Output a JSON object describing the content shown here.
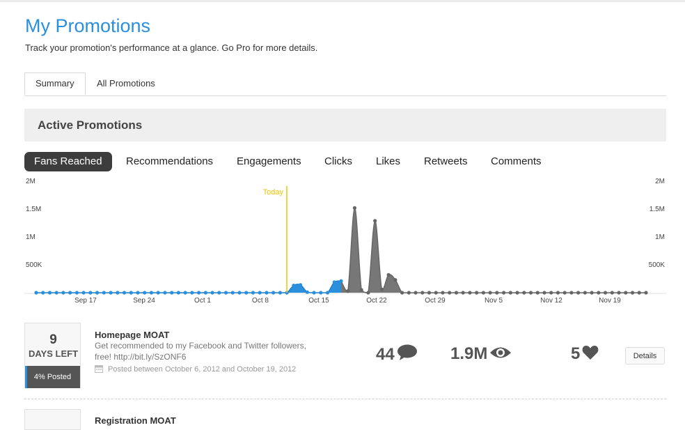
{
  "header": {
    "title": "My Promotions",
    "subtitle": "Track your promotion's performance at a glance. Go Pro for more details."
  },
  "tabs": [
    {
      "label": "Summary",
      "active": true
    },
    {
      "label": "All Promotions",
      "active": false
    }
  ],
  "section": {
    "title": "Active Promotions"
  },
  "metric_tabs": [
    {
      "label": "Fans Reached",
      "active": true
    },
    {
      "label": "Recommendations",
      "active": false
    },
    {
      "label": "Engagements",
      "active": false
    },
    {
      "label": "Clicks",
      "active": false
    },
    {
      "label": "Likes",
      "active": false
    },
    {
      "label": "Retweets",
      "active": false
    },
    {
      "label": "Comments",
      "active": false
    }
  ],
  "chart_data": {
    "type": "area",
    "y_ticks": [
      "2M",
      "1.5M",
      "1M",
      "500K"
    ],
    "ylim": [
      0,
      2000000
    ],
    "x_ticks": [
      "Sep 17",
      "Sep 24",
      "Oct 1",
      "Oct 8",
      "Oct 15",
      "Oct 22",
      "Oct 29",
      "Nov 5",
      "Nov 12",
      "Nov 19"
    ],
    "annotation": "Today",
    "colors": {
      "past": "#2a8fdc",
      "future": "#777777",
      "today": "#f2c200"
    },
    "series": [
      {
        "values": [
          0,
          0,
          0,
          0,
          0,
          0,
          0,
          0,
          0,
          0,
          0,
          0,
          0,
          0,
          0,
          0,
          0,
          0,
          0,
          0,
          0,
          0,
          0,
          0,
          0,
          0,
          0,
          0,
          0,
          0,
          0,
          0,
          0,
          0,
          0,
          0,
          0,
          0,
          130000,
          140000,
          10000,
          0,
          0,
          0,
          190000,
          210000,
          30000,
          1520000,
          50000,
          0,
          1290000,
          60000,
          320000,
          230000,
          0,
          0,
          0,
          0,
          0,
          0,
          0,
          0,
          0,
          0,
          0,
          0,
          0,
          0,
          0,
          0,
          0,
          0,
          0,
          0,
          0,
          0,
          0,
          0,
          0,
          0,
          0,
          0,
          0,
          0,
          0,
          0,
          0,
          0,
          0,
          0,
          0
        ]
      }
    ]
  },
  "promotions": [
    {
      "days": "9",
      "days_label": "DAYS LEFT",
      "posted": "4% Posted",
      "posted_fraction": 0.04,
      "title": "Homepage MOAT",
      "description": "Get recommended to my Facebook and Twitter followers, free! http://bit.ly/SzONF6",
      "date_range": "Posted between October 6, 2012 and October 19, 2012",
      "comments": "44",
      "views": "1.9M",
      "likes": "5",
      "details_label": "Details"
    },
    {
      "title": "Registration MOAT"
    }
  ]
}
